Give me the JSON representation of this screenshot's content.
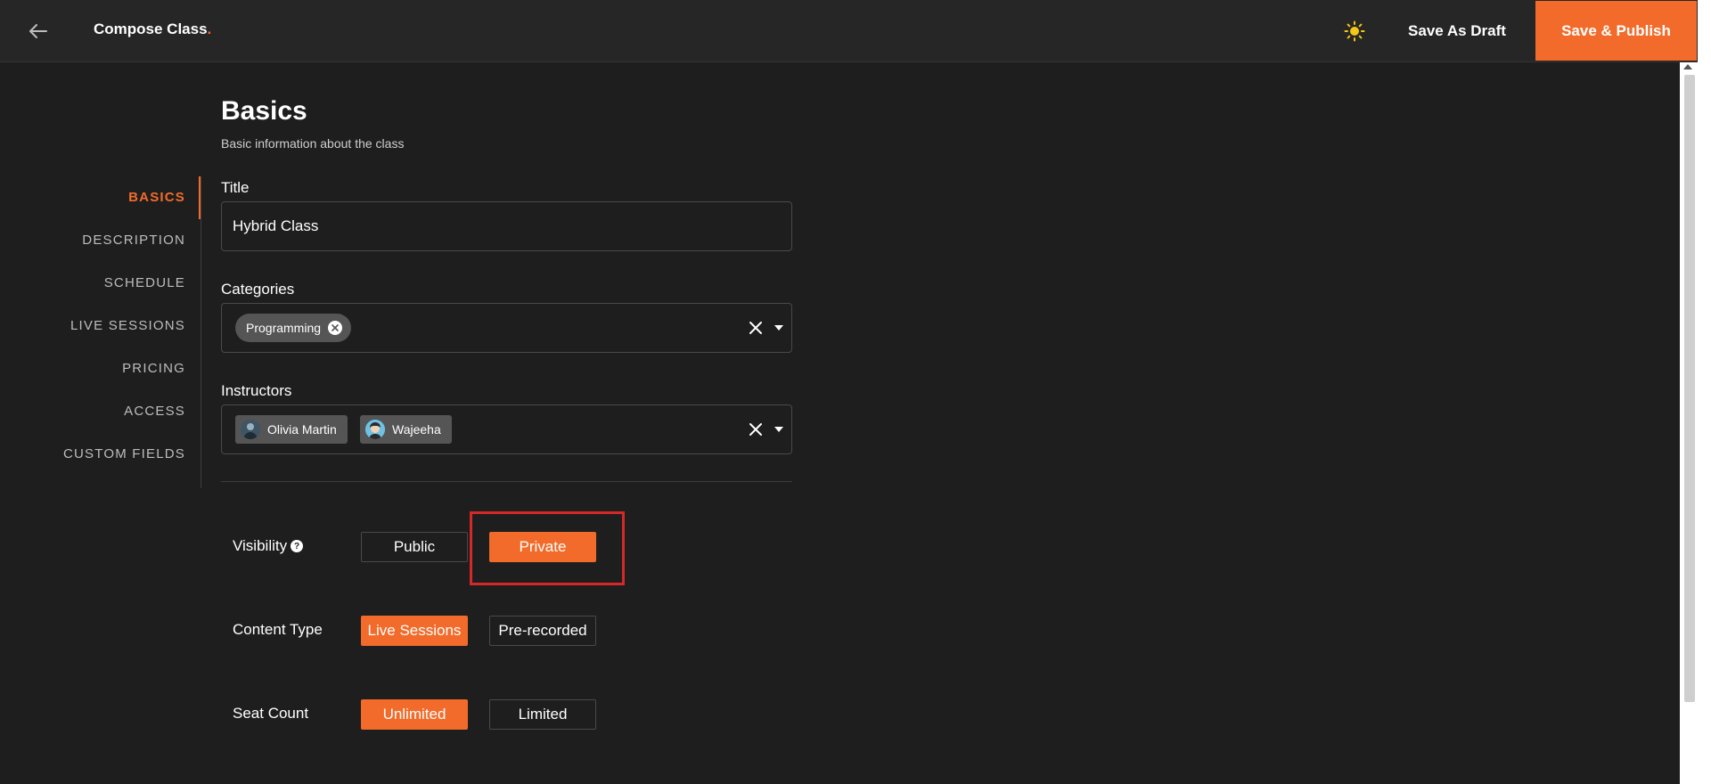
{
  "header": {
    "title": "Compose Class",
    "title_dot": ".",
    "save_draft_label": "Save As Draft",
    "save_publish_label": "Save & Publish"
  },
  "sidenav": {
    "items": [
      {
        "label": "BASICS",
        "active": true
      },
      {
        "label": "DESCRIPTION",
        "active": false
      },
      {
        "label": "SCHEDULE",
        "active": false
      },
      {
        "label": "LIVE SESSIONS",
        "active": false
      },
      {
        "label": "PRICING",
        "active": false
      },
      {
        "label": "ACCESS",
        "active": false
      },
      {
        "label": "CUSTOM FIELDS",
        "active": false
      }
    ]
  },
  "section": {
    "title": "Basics",
    "subtitle": "Basic information about the class"
  },
  "fields": {
    "title_label": "Title",
    "title_value": "Hybrid Class",
    "categories_label": "Categories",
    "categories": [
      "Programming"
    ],
    "instructors_label": "Instructors",
    "instructors": [
      "Olivia Martin",
      "Wajeeha"
    ]
  },
  "options": {
    "visibility": {
      "label": "Visibility",
      "help": "?",
      "choices": [
        "Public",
        "Private"
      ],
      "selected": "Private"
    },
    "content_type": {
      "label": "Content Type",
      "choices": [
        "Live Sessions",
        "Pre-recorded"
      ],
      "selected": "Live Sessions"
    },
    "seat_count": {
      "label": "Seat Count",
      "choices": [
        "Unlimited",
        "Limited"
      ],
      "selected": "Unlimited"
    }
  },
  "colors": {
    "accent": "#f26b2a",
    "background": "#1e1e1e",
    "topbar": "#262626",
    "highlight": "#d62828"
  },
  "icons": {
    "back": "arrow-left-icon",
    "theme": "sun-icon",
    "clear": "close-icon",
    "dropdown": "caret-down-icon",
    "chip_remove": "circle-x-icon",
    "help": "question-circle-icon"
  }
}
